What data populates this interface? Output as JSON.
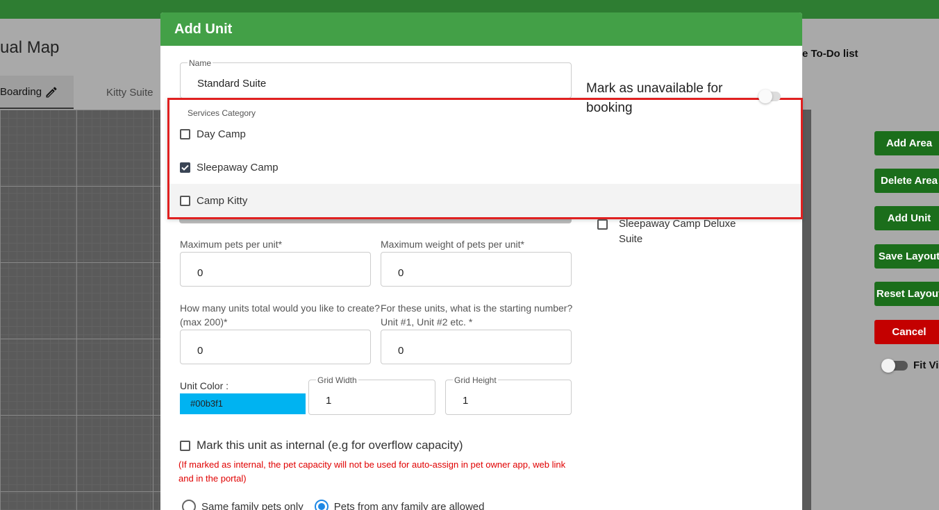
{
  "background": {
    "page_title": "ual Map",
    "tabs": [
      {
        "label": "Boarding"
      },
      {
        "label": "Kitty Suite"
      }
    ],
    "todo_link": "e To-Do list",
    "side_buttons": [
      "Add Area",
      "Delete Area",
      "Add Unit",
      "Save Layout",
      "Reset Layout",
      "Cancel"
    ],
    "fit_view_label": "Fit Vi"
  },
  "modal": {
    "title": "Add Unit",
    "name": {
      "legend": "Name",
      "value": "Standard Suite"
    },
    "services_category": {
      "legend": "Services Category",
      "options": [
        {
          "label": "Day Camp",
          "checked": false
        },
        {
          "label": "Sleepaway Camp",
          "checked": true
        },
        {
          "label": "Camp Kitty",
          "checked": false
        }
      ]
    },
    "unavailable_label": "Mark as unavailable for booking",
    "deluxe_option": "Sleepaway Camp Deluxe Suite",
    "max_pets": {
      "label": "Maximum pets per unit*",
      "value": "0"
    },
    "max_weight": {
      "label": "Maximum weight of pets per unit*",
      "value": "0"
    },
    "units_total": {
      "label": "How many units total would you like to create? (max 200)*",
      "value": "0"
    },
    "starting_number": {
      "label": "For these units, what is the starting number? Unit #1, Unit #2 etc. *",
      "value": "0"
    },
    "unit_color": {
      "label": "Unit Color :",
      "value": "#00b3f1"
    },
    "grid_width": {
      "legend": "Grid Width",
      "value": "1"
    },
    "grid_height": {
      "legend": "Grid Height",
      "value": "1"
    },
    "internal_label": "Mark this unit as internal (e.g for overflow capacity)",
    "internal_note": "(If marked as internal, the pet capacity will not be used for auto-assign in pet owner app, web link and in the portal)",
    "radio_same_family": "Same family pets only",
    "radio_any_family": "Pets from any family are allowed"
  },
  "colors": {
    "header": "#43a047",
    "highlight_box": "#e02020",
    "unit_color": "#00b3f1",
    "primary_button": "#1b6e1b",
    "cancel_button": "#c40000"
  }
}
